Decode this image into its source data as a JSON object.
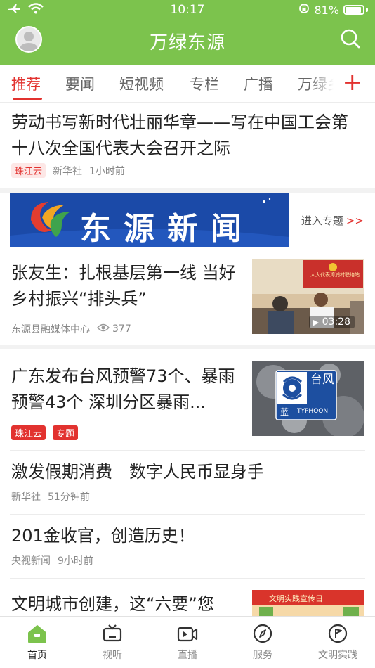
{
  "status_bar": {
    "time": "10:17",
    "battery_percent": "81%"
  },
  "header": {
    "title": "万绿东源"
  },
  "tabs": [
    {
      "label": "推荐",
      "active": true
    },
    {
      "label": "要闻"
    },
    {
      "label": "短视频"
    },
    {
      "label": "专栏"
    },
    {
      "label": "广播"
    },
    {
      "label": "万绿乡"
    }
  ],
  "tabs_add_label": "+",
  "articles": [
    {
      "title": "劳动书写新时代壮丽华章——写在中国工会第十八次全国代表大会召开之际",
      "tag": "珠江云",
      "source": "新华社",
      "time": "1小时前"
    },
    {
      "title": "张友生：扎根基层第一线 当好乡村振兴“排头兵”",
      "source": "东源县融媒体中心",
      "views": "377",
      "video_duration": "03:28",
      "thumb_sign": "人大代表漳浦村联络站"
    },
    {
      "title": "广东发布台风预警73个、暴雨预警43个 深圳分区暴雨...",
      "tags": [
        "珠江云",
        "专题"
      ],
      "thumb_badge_cn": "台风",
      "thumb_badge_en": "TYPHOON",
      "thumb_badge_level": "蓝"
    },
    {
      "title": "激发假期消费　数字人民币显身手",
      "source": "新华社",
      "time": "51分钟前"
    },
    {
      "title": "201金收官，创造历史！",
      "source": "央视新闻",
      "time": "9小时前"
    },
    {
      "title": "文明城市创建，这“六要”您",
      "thumb_banner": "文明实践宣传日"
    }
  ],
  "banner": {
    "text": "东源新闻",
    "link_label": "进入专题",
    "link_arrows": ">>"
  },
  "bottom_nav": [
    {
      "label": "首页",
      "icon": "home-icon",
      "active": true
    },
    {
      "label": "视听",
      "icon": "tv-icon"
    },
    {
      "label": "直播",
      "icon": "live-icon"
    },
    {
      "label": "服务",
      "icon": "compass-icon"
    },
    {
      "label": "文明实践",
      "icon": "flag-icon"
    }
  ],
  "colors": {
    "brand_green": "#7cc34d",
    "accent_red": "#e2322f",
    "banner_blue": "#1b4aa8"
  }
}
